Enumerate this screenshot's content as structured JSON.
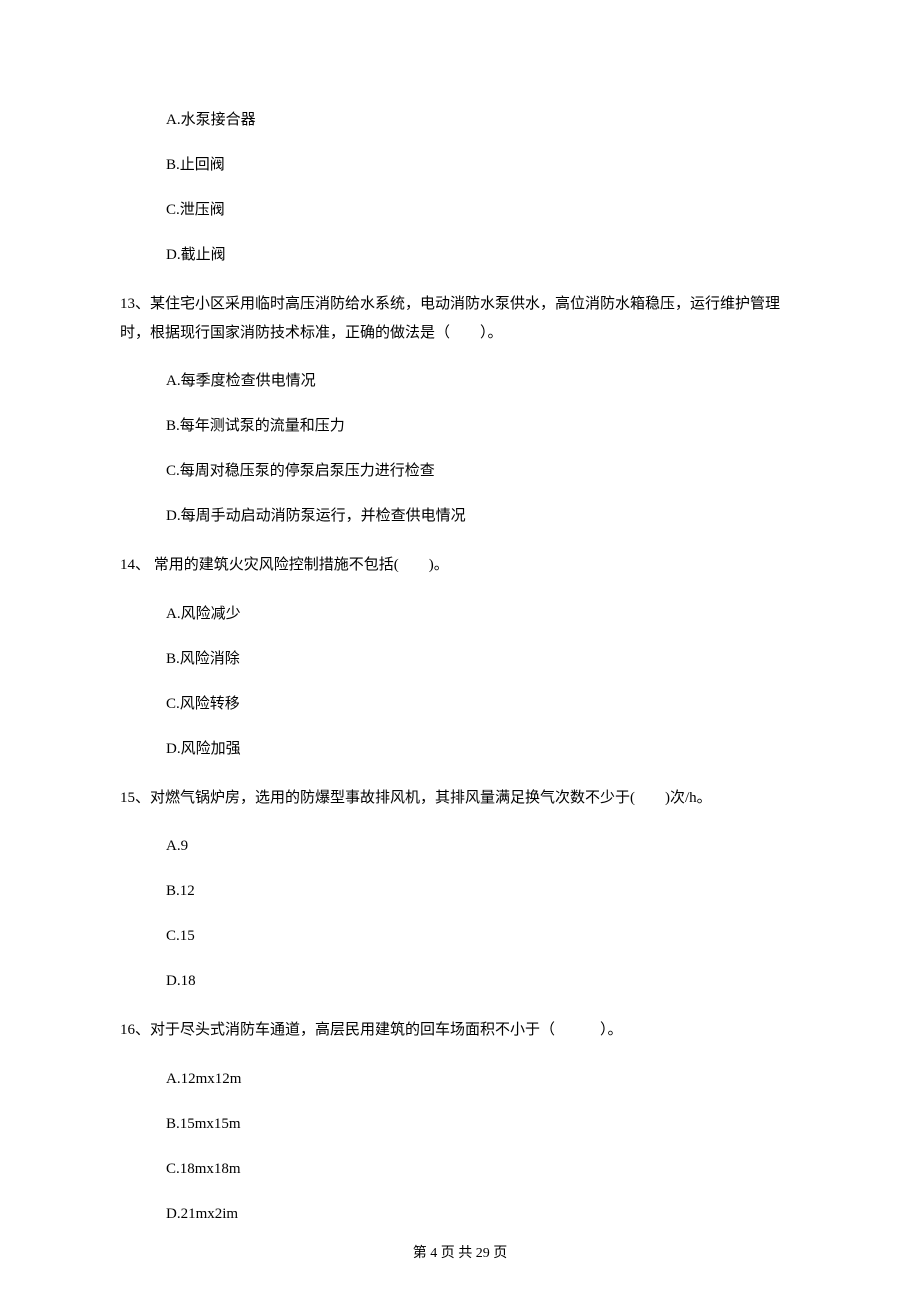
{
  "q12": {
    "options": {
      "a": "A.水泵接合器",
      "b": "B.止回阀",
      "c": "C.泄压阀",
      "d": "D.截止阀"
    }
  },
  "q13": {
    "text": "13、某住宅小区采用临时高压消防给水系统，电动消防水泵供水，高位消防水箱稳压，运行维护管理时，根据现行国家消防技术标准，正确的做法是（　　）。",
    "options": {
      "a": "A.每季度检查供电情况",
      "b": "B.每年测试泵的流量和压力",
      "c": "C.每周对稳压泵的停泵启泵压力进行检查",
      "d": "D.每周手动启动消防泵运行，并检查供电情况"
    }
  },
  "q14": {
    "text": "14、 常用的建筑火灾风险控制措施不包括(　　)。",
    "options": {
      "a": "A.风险减少",
      "b": "B.风险消除",
      "c": "C.风险转移",
      "d": "D.风险加强"
    }
  },
  "q15": {
    "text": "15、对燃气锅炉房，选用的防爆型事故排风机，其排风量满足换气次数不少于(　　)次/h。",
    "options": {
      "a": "A.9",
      "b": "B.12",
      "c": "C.15",
      "d": "D.18"
    }
  },
  "q16": {
    "text": "16、对于尽头式消防车通道，高层民用建筑的回车场面积不小于（　　　）。",
    "options": {
      "a": "A.12mx12m",
      "b": "B.15mx15m",
      "c": "C.18mx18m",
      "d": "D.21mx2im"
    }
  },
  "footer": "第 4 页 共 29 页"
}
